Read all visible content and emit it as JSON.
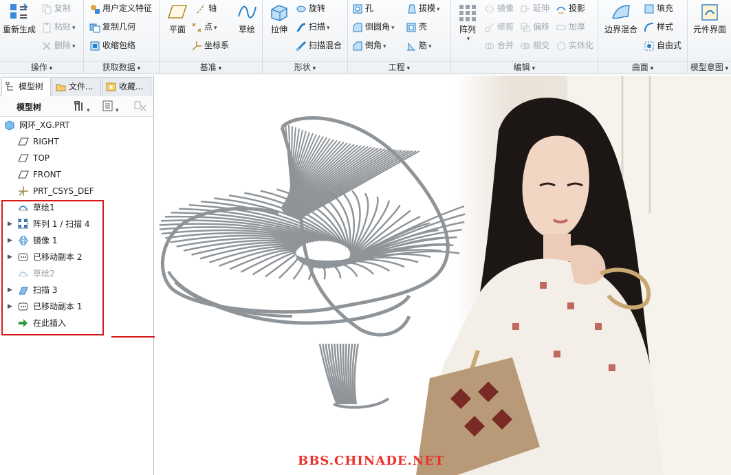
{
  "ribbon": {
    "groups": [
      {
        "label": "操作"
      },
      {
        "label": "获取数据"
      },
      {
        "label": "基准"
      },
      {
        "label": "形状"
      },
      {
        "label": "工程"
      },
      {
        "label": "编辑"
      },
      {
        "label": "曲面"
      },
      {
        "label": "模型意图"
      }
    ],
    "regenerate": "重新生成",
    "copy": "复制",
    "paste": "粘贴",
    "delete": "删除",
    "udf": "用户定义特征",
    "copy_geom": "复制几何",
    "shrinkwrap": "收缩包络",
    "plane": "平面",
    "axis": "轴",
    "point": "点",
    "csys": "坐标系",
    "sketch": "草绘",
    "extrude": "拉伸",
    "revolve": "旋转",
    "sweep": "扫描",
    "swept_blend": "扫描混合",
    "hole": "孔",
    "round": "倒圆角",
    "chamfer": "倒角",
    "draft": "拔模",
    "shell": "壳",
    "rib": "筋",
    "pattern": "阵列",
    "mirror": "镜像",
    "trim": "修剪",
    "merge": "合并",
    "extend": "延伸",
    "offset": "偏移",
    "intersect": "相交",
    "project": "投影",
    "thicken": "加厚",
    "solidify": "实体化",
    "boundary_blend": "边界混合",
    "fill": "填充",
    "style": "样式",
    "freestyle": "自由式",
    "component_interface": "元件界面"
  },
  "panel": {
    "tabs": [
      "模型树",
      "文件...",
      "收藏..."
    ],
    "tree_title": "模型树",
    "tree": [
      {
        "label": "网环_XG.PRT",
        "icon": "part-icon",
        "expandable": false,
        "disabled": false
      },
      {
        "label": "RIGHT",
        "icon": "datum-plane-icon",
        "expandable": false,
        "disabled": false
      },
      {
        "label": "TOP",
        "icon": "datum-plane-icon",
        "expandable": false,
        "disabled": false
      },
      {
        "label": "FRONT",
        "icon": "datum-plane-icon",
        "expandable": false,
        "disabled": false
      },
      {
        "label": "PRT_CSYS_DEF",
        "icon": "csys-icon",
        "expandable": false,
        "disabled": false
      },
      {
        "label": "草绘1",
        "icon": "sketch-icon",
        "expandable": false,
        "disabled": false
      },
      {
        "label": "阵列 1 / 扫描 4",
        "icon": "pattern-icon",
        "expandable": true,
        "disabled": false
      },
      {
        "label": "镜像 1",
        "icon": "mirror-icon",
        "expandable": true,
        "disabled": false
      },
      {
        "label": "已移动副本 2",
        "icon": "moved-copy-icon",
        "expandable": true,
        "disabled": false
      },
      {
        "label": "草绘2",
        "icon": "sketch-icon",
        "expandable": false,
        "disabled": true
      },
      {
        "label": "扫描 3",
        "icon": "sweep-icon",
        "expandable": true,
        "disabled": false
      },
      {
        "label": "已移动副本 1",
        "icon": "moved-copy-icon",
        "expandable": true,
        "disabled": false
      },
      {
        "label": "在此插入",
        "icon": "insert-here-icon",
        "expandable": false,
        "disabled": false
      }
    ]
  },
  "watermark": "BBS.CHINADE.NET",
  "colors": {
    "highlight": "#d81818",
    "accent_blue": "#2a7fc9",
    "mesh": "#8f9499",
    "watermark": "#e8322d"
  }
}
